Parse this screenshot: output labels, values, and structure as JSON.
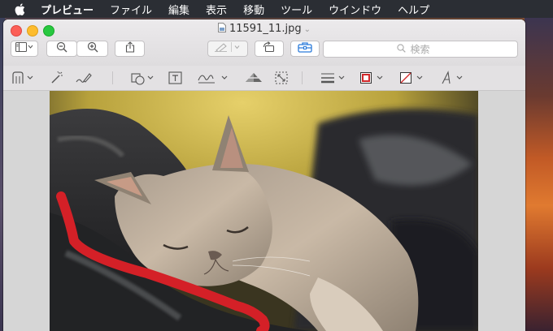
{
  "menubar": {
    "app_name": "プレビュー",
    "items": [
      "ファイル",
      "編集",
      "表示",
      "移動",
      "ツール",
      "ウインドウ",
      "ヘルプ"
    ]
  },
  "window": {
    "title": "11591_11.jpg",
    "search_placeholder": "検索"
  },
  "icons": {
    "apple": "apple-icon",
    "sidebar": "sidebar-icon",
    "zoom_out": "zoom-out-icon",
    "zoom_in": "zoom-in-icon",
    "share": "share-icon",
    "highlight": "highlighter-icon",
    "rotate": "rotate-icon",
    "toolbox": "toolbox-icon",
    "search": "search-icon"
  },
  "markup_tools": [
    "rect-selection-icon",
    "instant-alpha-icon",
    "sketch-icon",
    "shapes-icon",
    "text-icon",
    "sign-icon",
    "adjust-color-icon",
    "adjust-size-icon",
    "line-style-icon",
    "border-color-icon",
    "fill-color-icon",
    "font-style-icon"
  ],
  "colors": {
    "menubar_bg": "#2b2e34",
    "accent_blue": "#2a7ad9",
    "border_color": "#d0282a",
    "sketch_stroke": "#d42027"
  }
}
